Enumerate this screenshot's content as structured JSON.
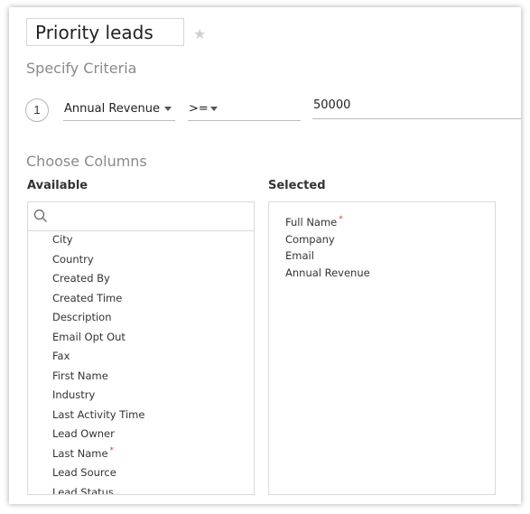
{
  "view": {
    "name": "Priority leads"
  },
  "criteria": {
    "heading": "Specify Criteria",
    "step_number": "1",
    "field": "Annual Revenue",
    "operator": ">=",
    "value": "50000"
  },
  "columns": {
    "heading": "Choose Columns",
    "available_label": "Available",
    "selected_label": "Selected",
    "search_placeholder": "",
    "available_items": [
      {
        "label": "City",
        "required": false
      },
      {
        "label": "Country",
        "required": false
      },
      {
        "label": "Created By",
        "required": false
      },
      {
        "label": "Created Time",
        "required": false
      },
      {
        "label": "Description",
        "required": false
      },
      {
        "label": "Email Opt Out",
        "required": false
      },
      {
        "label": "Fax",
        "required": false
      },
      {
        "label": "First Name",
        "required": false
      },
      {
        "label": "Industry",
        "required": false
      },
      {
        "label": "Last Activity Time",
        "required": false
      },
      {
        "label": "Lead Owner",
        "required": false
      },
      {
        "label": "Last Name",
        "required": true
      },
      {
        "label": "Lead Source",
        "required": false
      },
      {
        "label": "Lead Status",
        "required": false
      }
    ],
    "selected_items": [
      {
        "label": "Full Name",
        "required": true
      },
      {
        "label": "Company",
        "required": false
      },
      {
        "label": "Email",
        "required": false
      },
      {
        "label": "Annual Revenue",
        "required": false
      }
    ],
    "required_marker": "*"
  },
  "icons": {
    "favorite": "star-icon",
    "search": "search-icon",
    "dropdown": "caret-down-icon"
  },
  "colors": {
    "required_marker": "#e23b3b",
    "muted_heading": "#8a8a8a",
    "star_inactive": "#d0d0d0"
  }
}
